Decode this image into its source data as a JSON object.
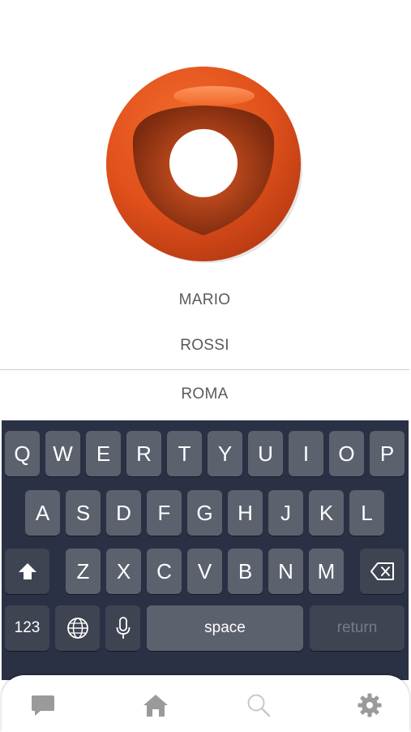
{
  "app": {
    "logo_icon": "orange-ring-logo",
    "accent_color": "#e2541e"
  },
  "form": {
    "fields": [
      {
        "value": "MARIO"
      },
      {
        "value": "ROSSI"
      },
      {
        "value": "ROMA"
      }
    ]
  },
  "keyboard": {
    "row1": [
      "Q",
      "W",
      "E",
      "R",
      "T",
      "Y",
      "U",
      "I",
      "O",
      "P"
    ],
    "row2": [
      "A",
      "S",
      "D",
      "F",
      "G",
      "H",
      "J",
      "K",
      "L"
    ],
    "row3": [
      "Z",
      "X",
      "C",
      "V",
      "B",
      "N",
      "M"
    ],
    "shift_icon": "shift-icon",
    "backspace_icon": "backspace-icon",
    "numbers_label": "123",
    "globe_icon": "globe-icon",
    "mic_icon": "microphone-icon",
    "space_label": "space",
    "return_label": "return"
  },
  "tabbar": {
    "items": [
      {
        "icon": "chat-icon"
      },
      {
        "icon": "home-icon"
      },
      {
        "icon": "search-icon"
      },
      {
        "icon": "settings-icon"
      }
    ]
  }
}
